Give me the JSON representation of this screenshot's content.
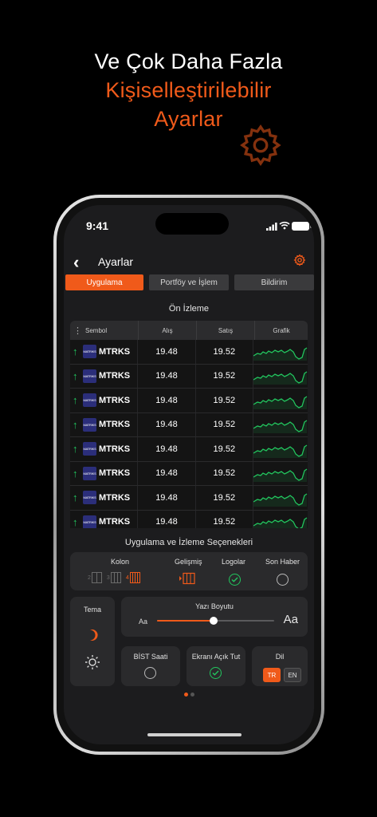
{
  "headline": {
    "line1": "Ve Çok Daha Fazla",
    "line2": "Kişiselleştirilebilir",
    "line3": "Ayarlar"
  },
  "colors": {
    "accent": "#f05a1a",
    "up": "#22c55e",
    "bg": "#1c1c1e",
    "card": "#2a2a2c"
  },
  "status_bar": {
    "time": "9:41"
  },
  "nav": {
    "title": "Ayarlar",
    "back_icon": "chevron-left-icon",
    "settings_icon": "gear-icon"
  },
  "tabs": [
    {
      "label": "Uygulama",
      "active": true
    },
    {
      "label": "Portföy ve İşlem",
      "active": false
    },
    {
      "label": "Bildirim",
      "active": false
    }
  ],
  "preview": {
    "title": "Ön İzleme",
    "columns": [
      "Sembol",
      "Alış",
      "Satış",
      "Grafik"
    ],
    "rows": [
      {
        "symbol": "MTRKS",
        "logo": "MATRIKS",
        "bid": "19.48",
        "ask": "19.52"
      },
      {
        "symbol": "MTRKS",
        "logo": "MATRIKS",
        "bid": "19.48",
        "ask": "19.52"
      },
      {
        "symbol": "MTRKS",
        "logo": "MATRIKS",
        "bid": "19.48",
        "ask": "19.52"
      },
      {
        "symbol": "MTRKS",
        "logo": "MATRIKS",
        "bid": "19.48",
        "ask": "19.52"
      },
      {
        "symbol": "MTRKS",
        "logo": "MATRIKS",
        "bid": "19.48",
        "ask": "19.52"
      },
      {
        "symbol": "MTRKS",
        "logo": "MATRIKS",
        "bid": "19.48",
        "ask": "19.52"
      },
      {
        "symbol": "MTRKS",
        "logo": "MATRIKS",
        "bid": "19.48",
        "ask": "19.52"
      },
      {
        "symbol": "MTRKS",
        "logo": "MATRIKS",
        "bid": "19.48",
        "ask": "19.52"
      }
    ]
  },
  "options": {
    "title": "Uygulama ve İzleme Seçenekleri",
    "kolon_label": "Kolon",
    "kolon_options": [
      {
        "label": "2",
        "active": false
      },
      {
        "label": "3",
        "active": false
      },
      {
        "label": "4",
        "active": true
      }
    ],
    "gelismis_label": "Gelişmiş",
    "logolar_label": "Logolar",
    "logolar_on": true,
    "son_haber_label": "Son Haber",
    "son_haber_on": false
  },
  "tema": {
    "label": "Tema",
    "dark_icon": "moon-icon",
    "light_icon": "sun-icon"
  },
  "yazi": {
    "label": "Yazı Boyutu",
    "small": "Aa",
    "large": "Aa",
    "level": 0.48
  },
  "bist": {
    "label": "BİST Saati",
    "on": false
  },
  "ekran": {
    "label": "Ekranı Açık Tut",
    "on": true
  },
  "dil": {
    "label": "Dil",
    "options": [
      "TR",
      "EN"
    ],
    "selected": "TR"
  }
}
